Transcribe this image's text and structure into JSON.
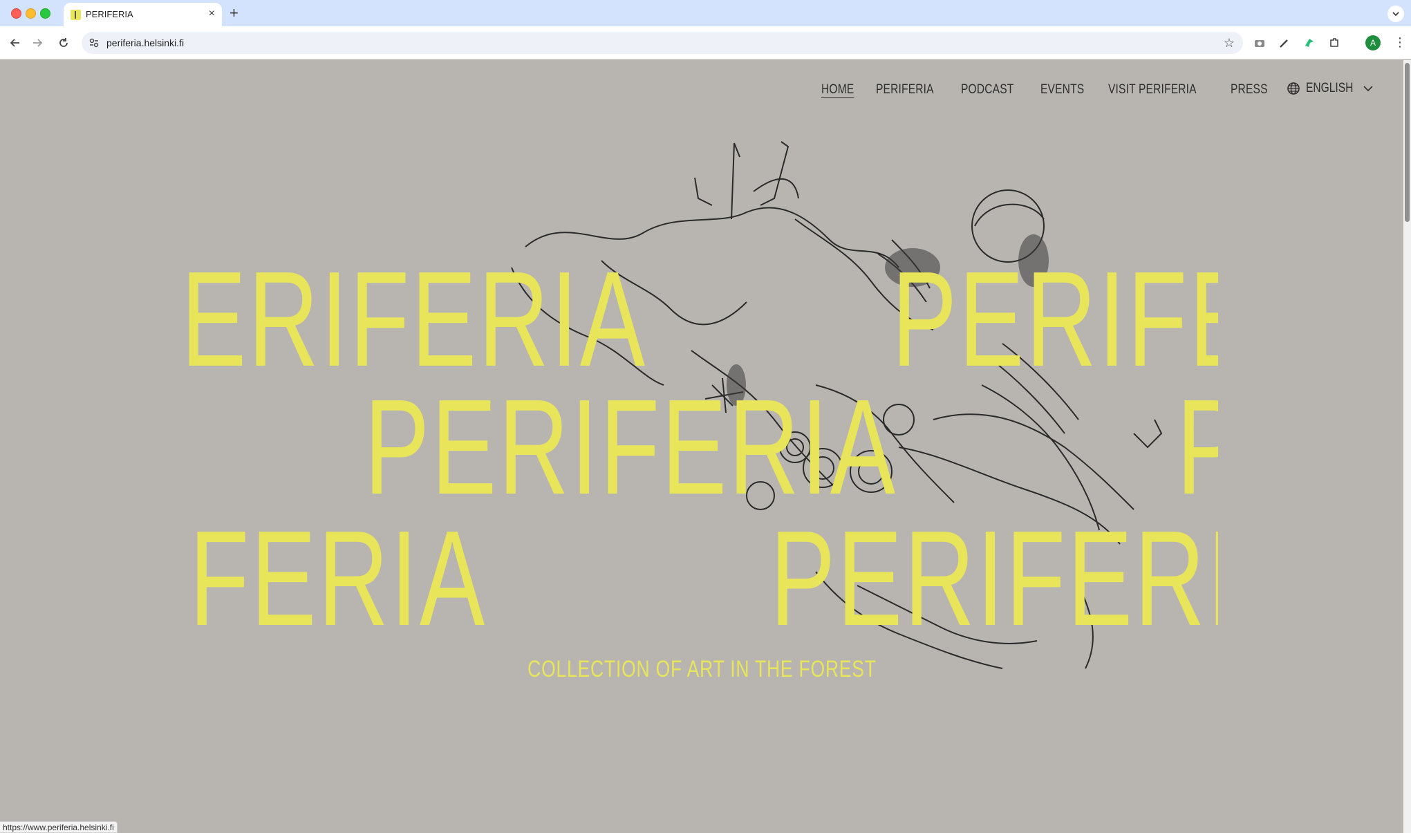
{
  "browser": {
    "tab_title": "PERIFERIA",
    "new_tab": "+",
    "close": "×",
    "url": "periferia.helsinki.fi",
    "profile_initial": "A",
    "status_url": "https://www.periferia.helsinki.fi"
  },
  "site": {
    "nav": [
      {
        "label": "HOME",
        "active": true
      },
      {
        "label": "PERIFERIA"
      },
      {
        "label": "PODCAST"
      },
      {
        "label": "EVENTS"
      },
      {
        "label": "VISIT PERIFERIA"
      },
      {
        "label": "PRESS"
      }
    ],
    "language": "ENGLISH",
    "hero_rows": [
      [
        "ERIFERIA",
        "PERIFE"
      ],
      [
        "PERIFERIA",
        "P"
      ],
      [
        "FERIA",
        "PERIFERI"
      ]
    ],
    "tagline": "COLLECTION OF ART IN THE FOREST",
    "colors": {
      "background": "#b8b5b1",
      "accent": "#e8e55b",
      "text": "#2e2e2e"
    }
  }
}
